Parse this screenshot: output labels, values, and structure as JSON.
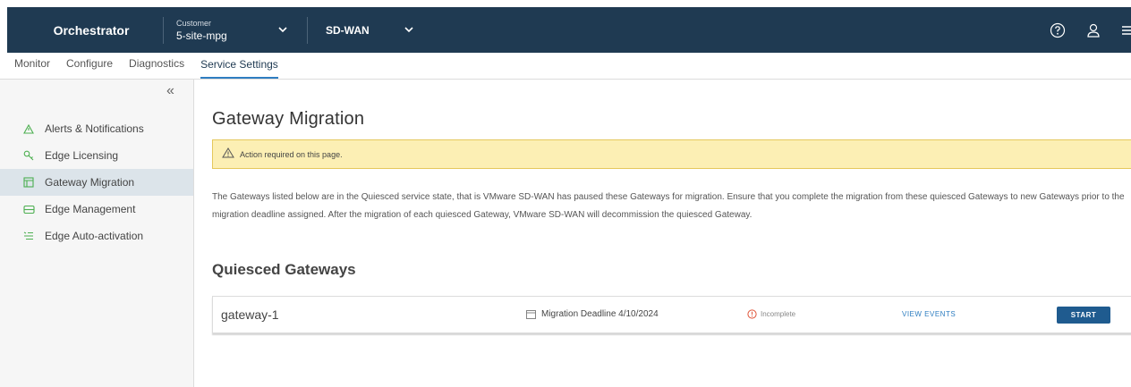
{
  "header": {
    "brand": "Orchestrator",
    "customer_label": "Customer",
    "customer_value": "5-site-mpg",
    "product": "SD-WAN",
    "icons": [
      "help-icon",
      "user-icon",
      "menu-icon"
    ]
  },
  "tabs": [
    {
      "label": "Monitor",
      "active": false
    },
    {
      "label": "Configure",
      "active": false
    },
    {
      "label": "Diagnostics",
      "active": false
    },
    {
      "label": "Service Settings",
      "active": true
    }
  ],
  "sidebar": {
    "collapse_icon": "«",
    "items": [
      {
        "label": "Alerts & Notifications",
        "icon": "alert-icon",
        "active": false
      },
      {
        "label": "Edge Licensing",
        "icon": "key-icon",
        "active": false
      },
      {
        "label": "Gateway Migration",
        "icon": "migration-icon",
        "active": true
      },
      {
        "label": "Edge Management",
        "icon": "edge-icon",
        "active": false
      },
      {
        "label": "Edge Auto-activation",
        "icon": "auto-activation-icon",
        "active": false
      }
    ]
  },
  "main": {
    "title": "Gateway Migration",
    "alert": "Action required on this page.",
    "description": "The Gateways listed below are in the Quiesced service state, that is VMware SD-WAN has paused these Gateways for migration. Ensure that you complete the migration from these quiesced Gateways to new Gateways prior to the migration deadline assigned. After the migration of each quiesced Gateway, VMware SD-WAN will decommission the quiesced Gateway.",
    "subtitle": "Quiesced Gateways",
    "gateway": {
      "name": "gateway-1",
      "deadline": "Migration Deadline 4/10/2024",
      "status": "Incomplete",
      "view_events": "VIEW EVENTS",
      "start": "START"
    }
  },
  "colors": {
    "header_bg": "#1f3a52",
    "accent": "#2f7ec1",
    "alert_bg": "#fcefb4",
    "start_button": "#1f5b8f",
    "status_incomplete": "#e0553a"
  }
}
